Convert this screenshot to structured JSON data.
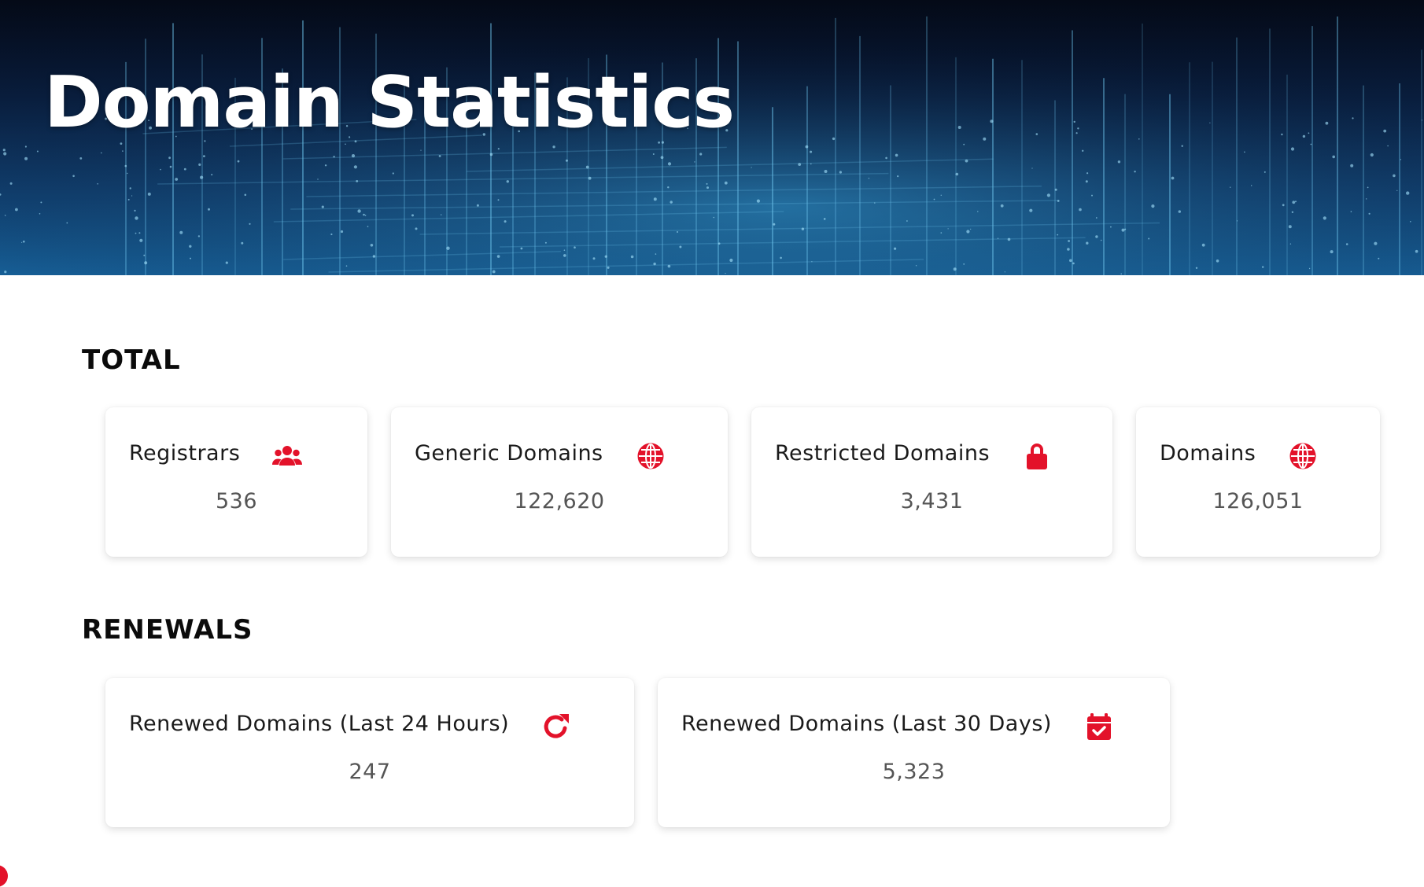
{
  "page": {
    "title": "Domain Statistics"
  },
  "accent_color": "#e3122a",
  "sections": {
    "total": {
      "title": "TOTAL",
      "cards": [
        {
          "label": "Registrars",
          "value": "536",
          "icon": "users-icon"
        },
        {
          "label": "Generic Domains",
          "value": "122,620",
          "icon": "globe-icon"
        },
        {
          "label": "Restricted Domains",
          "value": "3,431",
          "icon": "lock-icon"
        },
        {
          "label": "Domains",
          "value": "126,051",
          "icon": "globe-icon"
        }
      ]
    },
    "renewals": {
      "title": "RENEWALS",
      "cards": [
        {
          "label": "Renewed Domains (Last 24 Hours)",
          "value": "247",
          "icon": "refresh-icon"
        },
        {
          "label": "Renewed Domains (Last 30 Days)",
          "value": "5,323",
          "icon": "calendar-check-icon"
        }
      ]
    }
  }
}
